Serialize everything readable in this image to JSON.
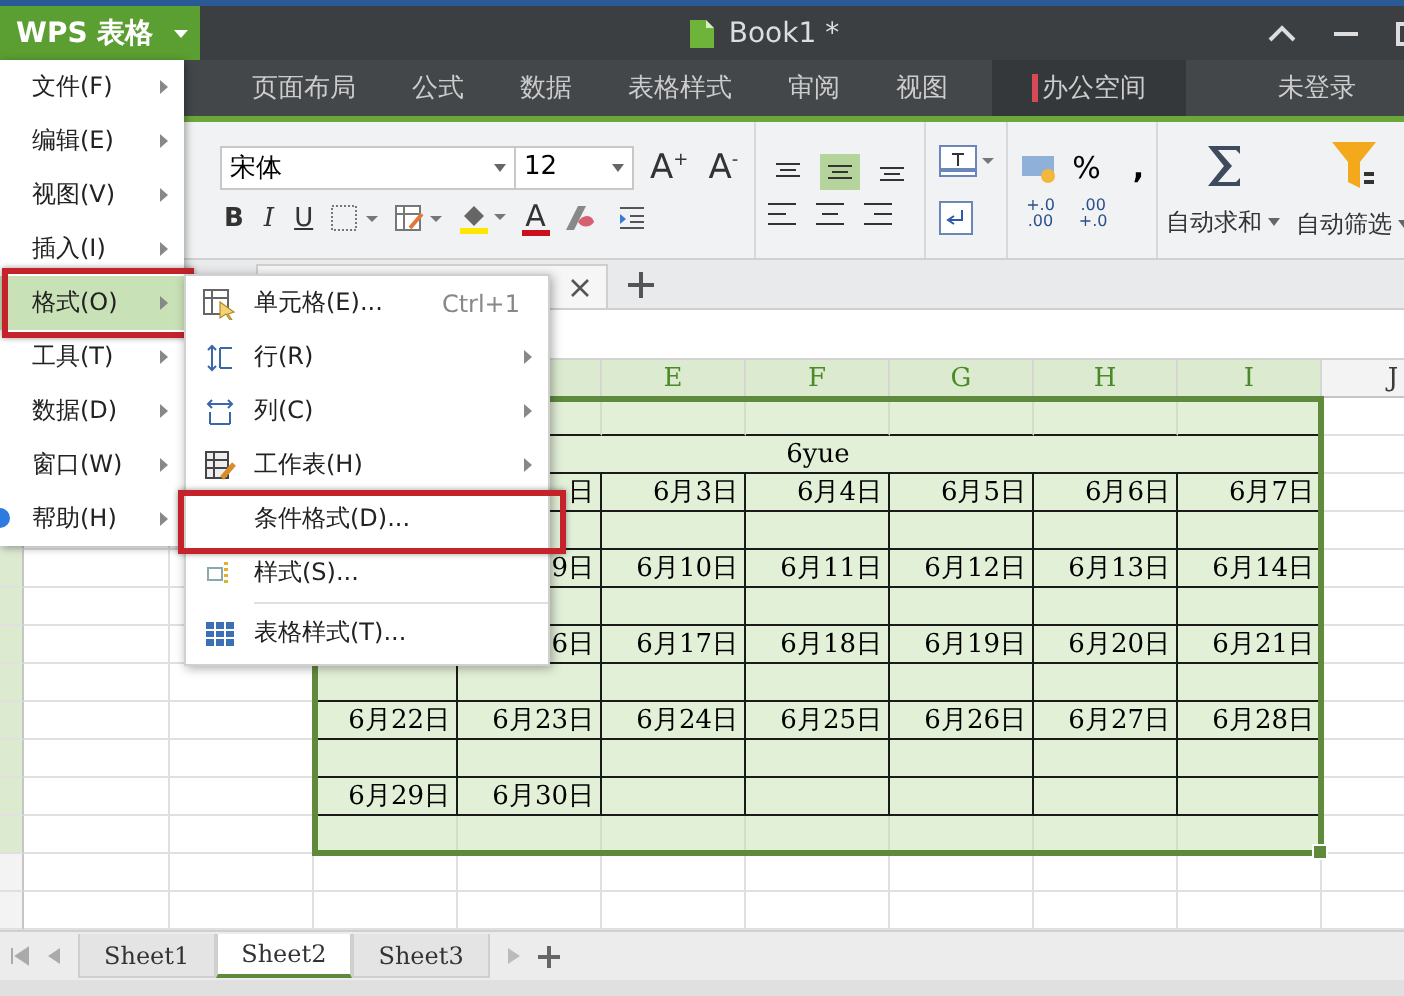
{
  "app_button": {
    "label": "WPS 表格"
  },
  "window": {
    "title": "Book1 *"
  },
  "ribbon_tabs": [
    {
      "label": "页面布局",
      "kind": "tab"
    },
    {
      "label": "公式",
      "kind": "tab"
    },
    {
      "label": "数据",
      "kind": "tab"
    },
    {
      "label": "表格样式",
      "kind": "tab"
    },
    {
      "label": "审阅",
      "kind": "tab"
    },
    {
      "label": "视图",
      "kind": "tab"
    },
    {
      "label": "办公空间",
      "kind": "space"
    }
  ],
  "login": "未登录",
  "toolbar": {
    "font": "宋体",
    "size": "12",
    "grow": "A",
    "grow_mark": "+",
    "shrink": "A",
    "shrink_mark": "-",
    "styles": [
      "B",
      "I",
      "U"
    ],
    "font_color": "A",
    "valign": [
      {
        "selected": false
      },
      {
        "selected": true
      },
      {
        "selected": false
      }
    ],
    "percent": "%",
    "comma": ",",
    "decimals": [
      [
        "+.0",
        ".00"
      ],
      [
        ".00",
        "+.0"
      ]
    ],
    "big_buttons": [
      {
        "label": "自动求和",
        "kind": "sum"
      },
      {
        "label": "自动筛选",
        "kind": "filter"
      }
    ]
  },
  "grid": {
    "column_headers": [
      "E",
      "F",
      "G",
      "H",
      "I",
      "J"
    ],
    "title": "6yue",
    "weeks": [
      {
        "kind": "tail",
        "cells": [
          "日",
          "6月3日",
          "6月4日",
          "6月5日",
          "6月6日",
          "6月7日"
        ]
      },
      {
        "kind": "tail",
        "cells": [
          "9日",
          "6月10日",
          "6月11日",
          "6月12日",
          "6月13日",
          "6月14日"
        ]
      },
      {
        "kind": "tail",
        "cells": [
          "6日",
          "6月17日",
          "6月18日",
          "6月19日",
          "6月20日",
          "6月21日"
        ]
      },
      {
        "kind": "head",
        "cells": [
          "6月22日",
          "6月23日",
          "6月24日",
          "6月25日",
          "6月26日",
          "6月27日",
          "6月28日"
        ]
      },
      {
        "kind": "head",
        "cells": [
          "6月29日",
          "6月30日"
        ]
      }
    ]
  },
  "sheet_tabs": [
    {
      "label": "Sheet1",
      "selected": false
    },
    {
      "label": "Sheet2",
      "selected": true
    },
    {
      "label": "Sheet3",
      "selected": false
    }
  ],
  "app_menu": [
    {
      "label": "文件(F)",
      "selected": false,
      "highlighted": false,
      "kind": "plain"
    },
    {
      "label": "编辑(E)",
      "selected": false,
      "highlighted": false,
      "kind": "plain"
    },
    {
      "label": "视图(V)",
      "selected": false,
      "highlighted": false,
      "kind": "plain"
    },
    {
      "label": "插入(I)",
      "selected": false,
      "highlighted": false,
      "kind": "plain"
    },
    {
      "label": "格式(O)",
      "selected": true,
      "highlighted": true,
      "kind": "plain"
    },
    {
      "label": "工具(T)",
      "selected": false,
      "highlighted": false,
      "kind": "plain"
    },
    {
      "label": "数据(D)",
      "selected": false,
      "highlighted": false,
      "kind": "plain"
    },
    {
      "label": "窗口(W)",
      "selected": false,
      "highlighted": false,
      "kind": "plain"
    },
    {
      "label": "帮助(H)",
      "selected": false,
      "highlighted": false,
      "kind": "help"
    }
  ],
  "format_menu": [
    {
      "label": "单元格(E)...",
      "shortcut": "Ctrl+1",
      "kind": "cell",
      "submenu": false,
      "highlighted": false
    },
    {
      "label": "行(R)",
      "kind": "row",
      "submenu": true,
      "highlighted": false
    },
    {
      "label": "列(C)",
      "kind": "column",
      "submenu": true,
      "highlighted": false
    },
    {
      "label": "工作表(H)",
      "kind": "sheet",
      "submenu": true,
      "highlighted": false
    },
    {
      "label": "条件格式(D)...",
      "kind": "none",
      "submenu": false,
      "highlighted": true
    },
    {
      "label": "样式(S)...",
      "kind": "style",
      "submenu": false,
      "highlighted": false
    },
    {
      "label": "表格样式(T)...",
      "kind": "table",
      "submenu": false,
      "highlighted": false
    }
  ]
}
